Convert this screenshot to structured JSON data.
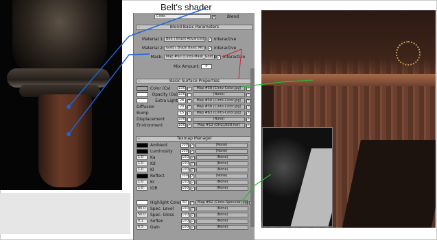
{
  "caption": "Belt's shader",
  "header": {
    "material_name": "Cinto",
    "type_button": "Blend"
  },
  "blend_params": {
    "title": "Blend Basic Parameters",
    "material1": {
      "label": "Material 1:",
      "value": "Belt ( Brazil Advanced )",
      "interactive": "Interactive"
    },
    "material2": {
      "label": "Material 2:",
      "value": "Gold ( Brazil Basic Mtl )",
      "interactive": "Interactive"
    },
    "mask": {
      "label": "Mask:",
      "value": "Map #60 (Cinto-Mask_Gold.jpg)",
      "interactive": "Interactive"
    },
    "mix_amount": {
      "label": "Mix Amount:",
      "value": "0"
    }
  },
  "surface": {
    "title": "Basic Surface Properties",
    "rows": [
      {
        "label": "Color (Cs)",
        "amount": "100",
        "map": "Map #58 (Cinto-Color.jpg)"
      },
      {
        "label": "Opacity (Os)",
        "amount": "100",
        "map": "(None)"
      },
      {
        "label": "Extra Light",
        "amount": "28",
        "map": "Map #58 (Cinto-Color.jpg)"
      },
      {
        "label": "Diffusion",
        "amount": "20",
        "map": "Map #58 (Cinto-Color.jpg)"
      },
      {
        "label": "Bump",
        "amount": "15",
        "map": "Map #63 (Cinto-Color.jpg)"
      },
      {
        "label": "Displacement",
        "amount": "100",
        "map": "(None)"
      },
      {
        "label": "Environment",
        "amount": "100",
        "map": "Map #13 (DH218SN.hdr)"
      }
    ]
  },
  "texmap": {
    "title": "Texmap Manager",
    "rows": [
      {
        "label": "Ambient",
        "value": "",
        "amount": "100",
        "map": "(None)"
      },
      {
        "label": "Luminosity",
        "value": "",
        "amount": "100",
        "map": "(None)"
      },
      {
        "label": "Ka",
        "value": "1.0",
        "amount": "100",
        "map": "(None)"
      },
      {
        "label": "Kd",
        "value": "1.0",
        "amount": "100",
        "map": "(None)"
      },
      {
        "label": "Kl",
        "value": "1.0",
        "amount": "100",
        "map": "(None)"
      },
      {
        "label": "Reflect",
        "value": "",
        "amount": "100",
        "map": "(None)"
      },
      {
        "label": "Kr",
        "value": "1.0",
        "amount": "100",
        "map": "(None)"
      },
      {
        "label": "IOR",
        "value": "1.0",
        "amount": "100",
        "map": "(None)"
      }
    ],
    "highlight": [
      {
        "label": "Highlight Color",
        "value": "",
        "amount": "50",
        "map": "Map #62 (Cinto-Specular.jpg)"
      },
      {
        "label": "Spec. Level",
        "value": "80.0",
        "amount": "100",
        "map": "(None)"
      },
      {
        "label": "Spec. Gloss",
        "value": "50.0",
        "amount": "100",
        "map": "(None)"
      },
      {
        "label": "Soften",
        "value": "0.1",
        "amount": "100",
        "map": "(None)"
      },
      {
        "label": "Gain",
        "value": "0.5",
        "amount": "100",
        "map": "(None)"
      }
    ]
  },
  "colors": {
    "connector_blue": "#1e63d6",
    "connector_green": "#2fb82f",
    "connector_red": "#d0202a"
  }
}
